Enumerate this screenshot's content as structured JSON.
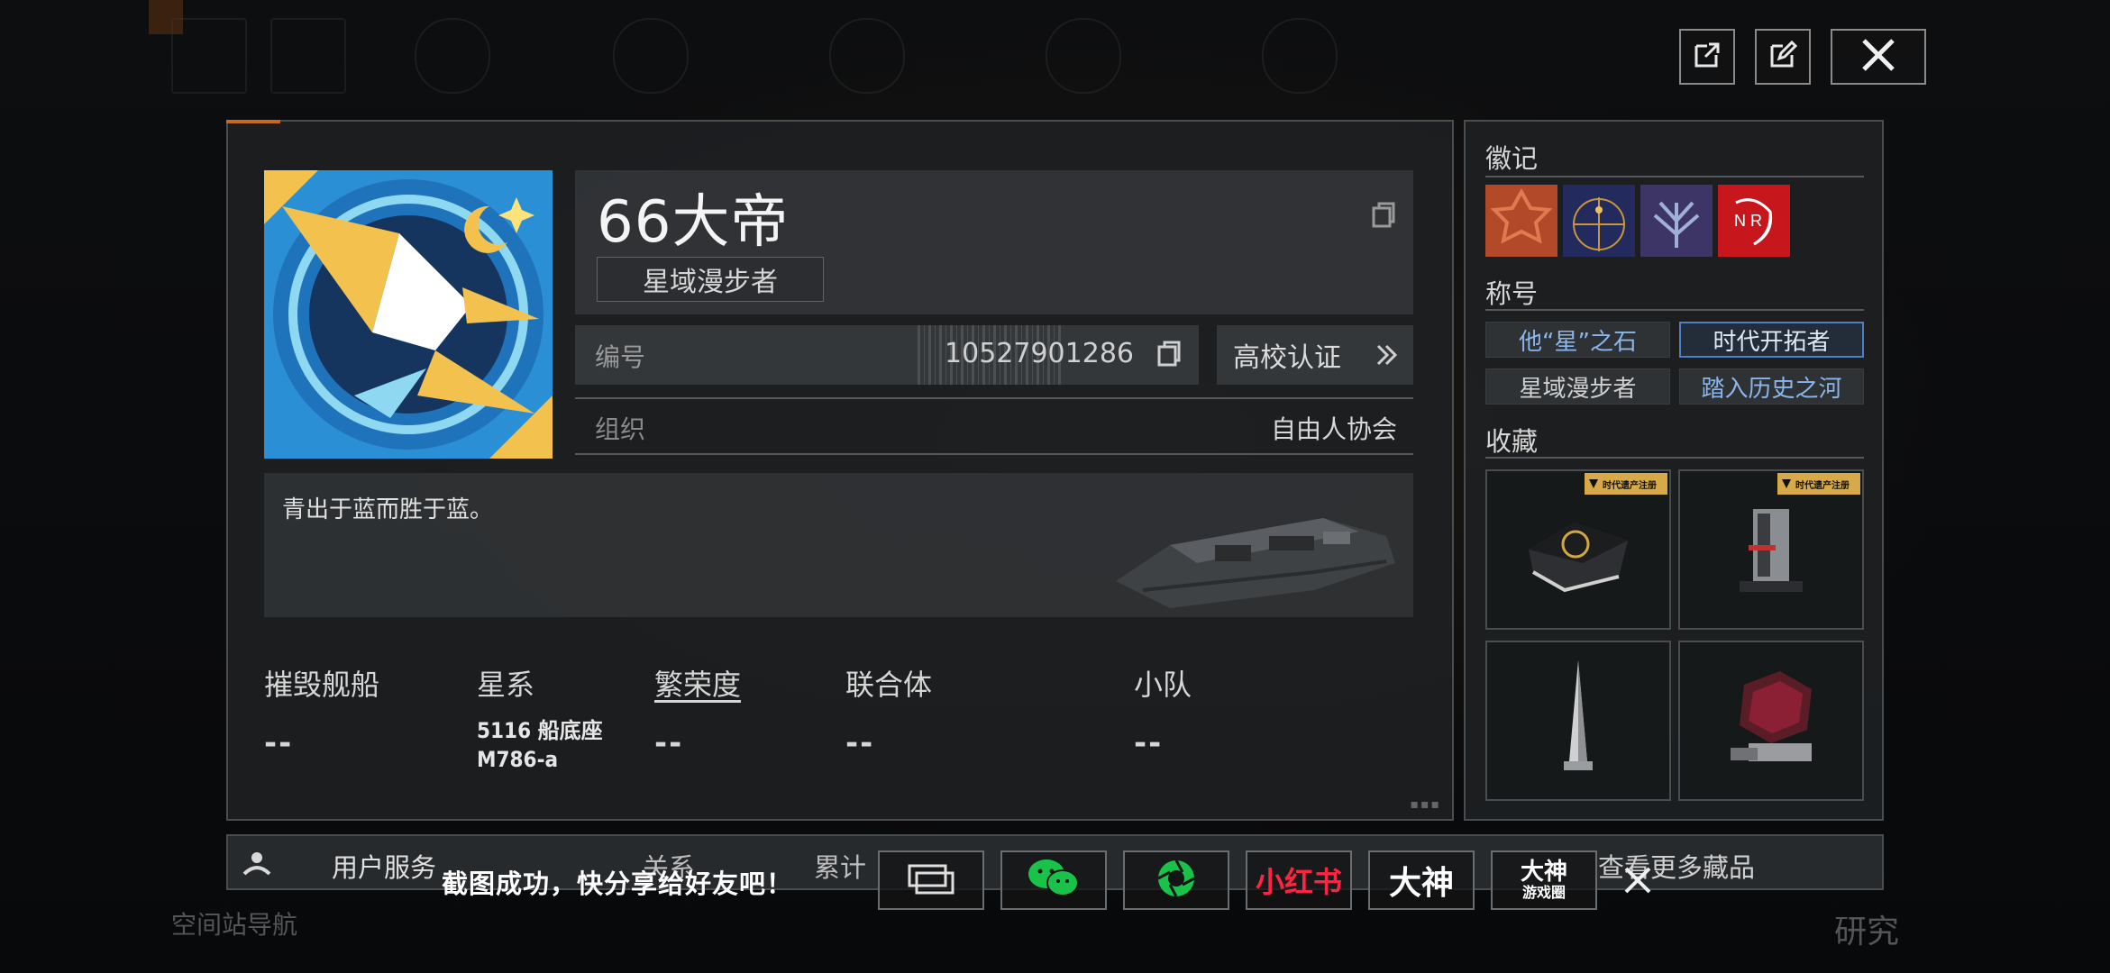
{
  "top_actions": {
    "open_external_icon": "external-link-icon",
    "edit_icon": "edit-icon",
    "close_icon": "close-icon"
  },
  "profile": {
    "name": "66大帝",
    "current_title": "星域漫步者",
    "id_label": "编号",
    "id_value": "10527901286",
    "campus_button": "高校认证",
    "org_label": "组织",
    "org_value": "自由人协会",
    "motto": "青出于蓝而胜于蓝。"
  },
  "stats": [
    {
      "label": "摧毁舰船",
      "value": "--"
    },
    {
      "label": "星系",
      "value_line1": "5116 船底座",
      "value_line2": "M786-a"
    },
    {
      "label": "繁荣度",
      "value": "--"
    },
    {
      "label": "联合体",
      "value": "--"
    },
    {
      "label": "小队",
      "value": "--"
    }
  ],
  "side": {
    "badges_title": "徽记",
    "titles_title": "称号",
    "titles": [
      {
        "label": "他“星”之石",
        "style": "blue"
      },
      {
        "label": "时代开拓者",
        "style": "selected"
      },
      {
        "label": "星域漫步者",
        "style": "gray"
      },
      {
        "label": "踏入历史之河",
        "style": "blue"
      }
    ],
    "collection_title": "收藏",
    "heritage_tag": "时代遗产注册"
  },
  "bottom_bar": {
    "user_service": "用户服务",
    "relation": "关系",
    "stats": "累计",
    "more_collection": "查看更多藏品"
  },
  "share": {
    "message": "截图成功，快分享给好友吧！",
    "xiaohongshu": "小红书",
    "dashen": "大神",
    "dashen_circle_top": "大神",
    "dashen_circle_bottom": "游戏圈"
  },
  "background": {
    "nav_hint": "空间站导航",
    "research": "研究"
  },
  "colors": {
    "accent_orange": "#c8681e",
    "title_blue": "#8bb6ea",
    "selected_border": "#4d7fc4",
    "wechat_green": "#19c34a",
    "xiaohongshu_red": "#ff2442",
    "heritage_gold": "#d7a948"
  }
}
